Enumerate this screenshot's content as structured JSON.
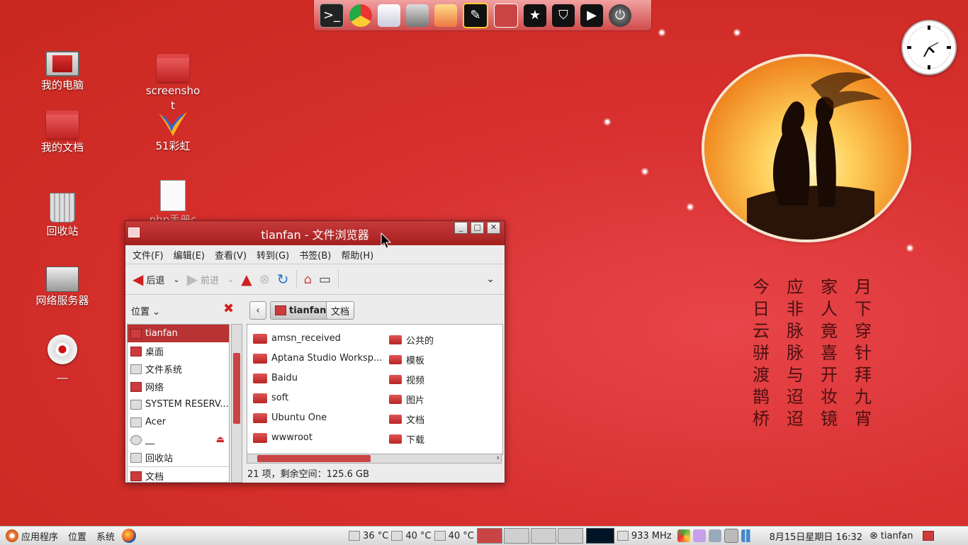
{
  "desktop": {
    "icons": [
      {
        "label": "我的电脑"
      },
      {
        "label": "我的文档"
      },
      {
        "label": "回收站"
      },
      {
        "label": "网络服务器"
      },
      {
        "label": "__"
      },
      {
        "label": "screenshot"
      },
      {
        "label": "51彩虹"
      },
      {
        "label": "php手册chm"
      }
    ],
    "poem": [
      "月下穿针拜九宵",
      "家人竟喜开妆镜",
      "应非脉脉与迢迢",
      "今日云骈渡鹊桥"
    ]
  },
  "dock": {
    "icons": [
      "terminal-icon",
      "chrome-icon",
      "mail-icon",
      "camera-icon",
      "paint-icon",
      "notes-icon",
      "window-icon",
      "star-icon",
      "shield-icon",
      "media-player-icon",
      "power-icon"
    ]
  },
  "window": {
    "title": "tianfan - 文件浏览器",
    "menu": [
      "文件(F)",
      "编辑(E)",
      "查看(V)",
      "转到(G)",
      "书签(B)",
      "帮助(H)"
    ],
    "toolbar": {
      "back": "后退",
      "forward": "前进"
    },
    "places_label": "位置",
    "breadcrumb": [
      "tianfan",
      "文档"
    ],
    "sidebar": [
      "tianfan",
      "桌面",
      "文件系统",
      "网络",
      "SYSTEM RESERV...",
      "Acer",
      "__",
      "回收站",
      "文档"
    ],
    "files_left": [
      "amsn_received",
      "Aptana Studio Worksp...",
      "Baidu",
      "soft",
      "Ubuntu One",
      "wwwroot"
    ],
    "files_right": [
      "公共的",
      "模板",
      "视频",
      "图片",
      "文档",
      "下载"
    ],
    "status": "21 项，剩余空间：125.6 GB"
  },
  "panel": {
    "apps": "应用程序",
    "places": "位置",
    "system": "系统",
    "temp1": "36 °C",
    "temp2": "40 °C",
    "temp3": "40 °C",
    "cpu_freq": "933 MHz",
    "datetime": "8月15日星期日 16:32",
    "user": "tianfan"
  }
}
